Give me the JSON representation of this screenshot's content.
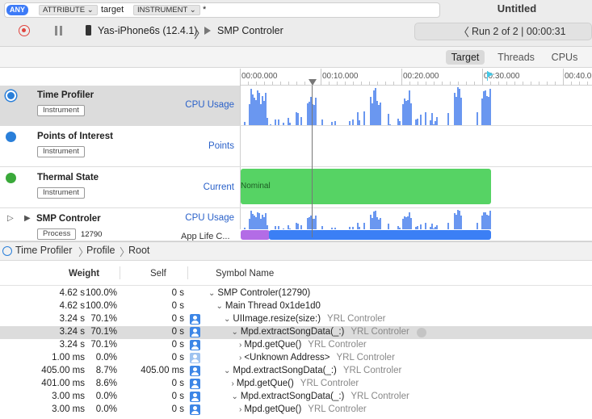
{
  "window": {
    "title": "Untitled"
  },
  "toolbar": {
    "device": "Yas-iPhone6s (12.4.1)",
    "target": "SMP Controler",
    "run": "Run 2 of 2  |  00:00:31"
  },
  "filter": {
    "any": "ANY",
    "attribute": "ATTRIBUTE ⌄",
    "attribute_value": "target",
    "instrument": "INSTRUMENT ⌄",
    "instrument_value": "*"
  },
  "scope_tabs": {
    "target": "Target",
    "threads": "Threads",
    "cpus": "CPUs"
  },
  "ruler": [
    "00:00.000",
    "00:10.000",
    "00:20.000",
    "00:30.000",
    "00:40.0"
  ],
  "tracks": [
    {
      "name": "Time Profiler",
      "badge": "Instrument",
      "type": "CPU Usage",
      "icon_color": "#2a7fd9"
    },
    {
      "name": "Points of Interest",
      "badge": "Instrument",
      "type": "Points",
      "icon_color": "#2a7fd9"
    },
    {
      "name": "Thermal State",
      "badge": "Instrument",
      "type": "Current",
      "icon_color": "#3aa93a",
      "band_label": "Nominal"
    },
    {
      "name": "SMP Controler",
      "badge": "Process",
      "pid": "12790",
      "type": "CPU Usage",
      "sub_type": "App Life C..."
    }
  ],
  "detail_breadcrumb": [
    "Time Profiler",
    "Profile",
    "Root"
  ],
  "columns": {
    "weight": "Weight",
    "self": "Self",
    "symbol": "Symbol Name"
  },
  "call_tree": [
    {
      "weight": "4.62 s",
      "pct": "100.0%",
      "self": "0 s",
      "symbol": "SMP Controler",
      "lib": "",
      "pid": "(12790)",
      "chev": "⌄",
      "indent": 0,
      "icon": "none"
    },
    {
      "weight": "4.62 s",
      "pct": "100.0%",
      "self": "0 s",
      "symbol": "Main Thread  0x1de1d0",
      "lib": "",
      "pid": "",
      "chev": "⌄",
      "indent": 1,
      "icon": "none"
    },
    {
      "weight": "3.24 s",
      "pct": "70.1%",
      "self": "0 s",
      "symbol": "UIImage.resize(size:)",
      "lib": "YRL Controler",
      "pid": "",
      "chev": "⌄",
      "indent": 2,
      "icon": "user"
    },
    {
      "weight": "3.24 s",
      "pct": "70.1%",
      "self": "0 s",
      "symbol": "Mpd.extractSongData(_:)",
      "lib": "YRL Controler",
      "pid": "",
      "chev": "⌄",
      "indent": 3,
      "icon": "user",
      "selected": true
    },
    {
      "weight": "3.24 s",
      "pct": "70.1%",
      "self": "0 s",
      "symbol": "Mpd.getQue()",
      "lib": "YRL Controler",
      "pid": "",
      "chev": "›",
      "indent": 4,
      "icon": "user"
    },
    {
      "weight": "1.00 ms",
      "pct": "0.0%",
      "self": "0 s",
      "symbol": "<Unknown Address>",
      "lib": "YRL Controler",
      "pid": "",
      "chev": "›",
      "indent": 4,
      "icon": "dim"
    },
    {
      "weight": "405.00 ms",
      "pct": "8.7%",
      "self": "405.00 ms",
      "symbol": "Mpd.extractSongData(_:)",
      "lib": "YRL Controler",
      "pid": "",
      "chev": "⌄",
      "indent": 2,
      "icon": "user"
    },
    {
      "weight": "401.00 ms",
      "pct": "8.6%",
      "self": "0 s",
      "symbol": "Mpd.getQue()",
      "lib": "YRL Controler",
      "pid": "",
      "chev": "›",
      "indent": 3,
      "icon": "user"
    },
    {
      "weight": "3.00 ms",
      "pct": "0.0%",
      "self": "0 s",
      "symbol": "Mpd.extractSongData(_:)",
      "lib": "YRL Controler",
      "pid": "",
      "chev": "⌄",
      "indent": 3,
      "icon": "user"
    },
    {
      "weight": "3.00 ms",
      "pct": "0.0%",
      "self": "0 s",
      "symbol": "Mpd.getQue()",
      "lib": "YRL Controler",
      "pid": "",
      "chev": "›",
      "indent": 4,
      "icon": "user"
    }
  ]
}
